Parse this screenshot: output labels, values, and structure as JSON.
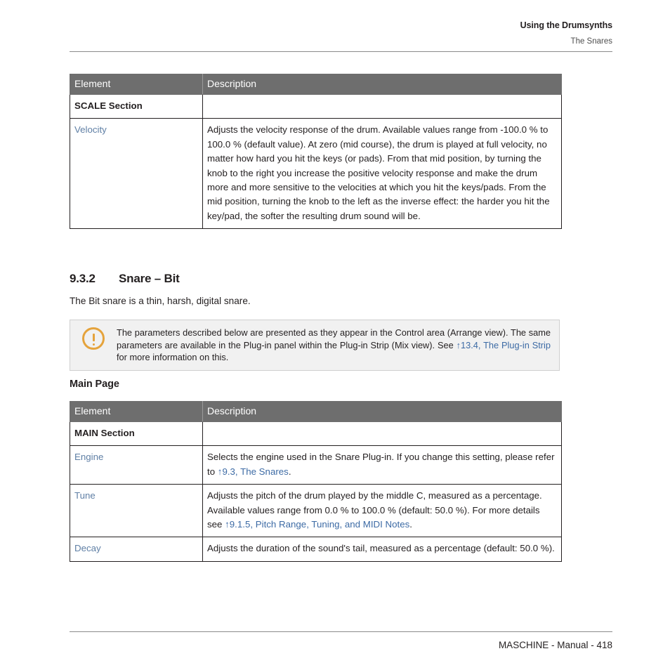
{
  "header": {
    "chapter": "Using the Drumsynths",
    "section": "The Snares"
  },
  "tables": {
    "scale": {
      "columns": [
        "Element",
        "Description"
      ],
      "rows": [
        {
          "element": "SCALE Section",
          "element_style": "section",
          "description": ""
        },
        {
          "element": "Velocity",
          "element_style": "link",
          "description": "Adjusts the velocity response of the drum. Available values range from -100.0 % to 100.0 % (default value). At zero (mid course), the drum is played at full velocity, no matter how hard you hit the keys (or pads). From that mid position, by turning the knob to the right you increase the positive velocity response and make the drum more and more sensitive to the velocities at which you hit the keys/pads. From the mid position, turning the knob to the left as the inverse effect: the harder you hit the key/pad, the softer the resulting drum sound will be."
        }
      ]
    },
    "main": {
      "columns": [
        "Element",
        "Description"
      ],
      "rows": [
        {
          "element": "MAIN Section",
          "element_style": "section",
          "description": ""
        },
        {
          "element": "Engine",
          "element_style": "link",
          "description_parts": [
            {
              "text": "Selects the engine used in the Snare Plug-in. If you change this setting, please refer to ",
              "link": false
            },
            {
              "text": "↑9.3, The Snares",
              "link": true
            },
            {
              "text": ".",
              "link": false
            }
          ]
        },
        {
          "element": "Tune",
          "element_style": "link",
          "description_parts": [
            {
              "text": "Adjusts the pitch of the drum played by the middle C, measured as a percentage. Available values range from 0.0 % to 100.0 % (default: 50.0 %). For more details see ",
              "link": false
            },
            {
              "text": "↑9.1.5, Pitch Range, Tuning, and MIDI Notes",
              "link": true
            },
            {
              "text": ".",
              "link": false
            }
          ]
        },
        {
          "element": "Decay",
          "element_style": "link",
          "description_parts": [
            {
              "text": "Adjusts the duration of the sound's tail, measured as a percentage (default: 50.0 %).",
              "link": false
            }
          ]
        }
      ]
    }
  },
  "section_heading": {
    "number": "9.3.2",
    "title": "Snare – Bit"
  },
  "intro_paragraph": "The Bit snare is a thin, harsh, digital snare.",
  "subheading": "Main Page",
  "note": {
    "icon": "warning-circle-icon",
    "parts": [
      {
        "text": "The parameters described below are presented as they appear in the Control area (Arrange view). The same parameters are available in the Plug-in panel within the Plug-in Strip (Mix view). See ",
        "link": false
      },
      {
        "text": "↑13.4, The Plug-in Strip",
        "link": true
      },
      {
        "text": " for more information on this.",
        "link": false
      }
    ]
  },
  "footer": {
    "text": "MASCHINE - Manual - 418"
  },
  "colors": {
    "table_header_bg": "#6e6e6e",
    "element_link": "#5f7fa5",
    "xref_link": "#3d6ba5",
    "note_bg": "#f1f1f1",
    "note_border": "#cfcfcf",
    "note_icon": "#e5a33c",
    "rule": "#8a8a8a",
    "text": "#231f20"
  }
}
